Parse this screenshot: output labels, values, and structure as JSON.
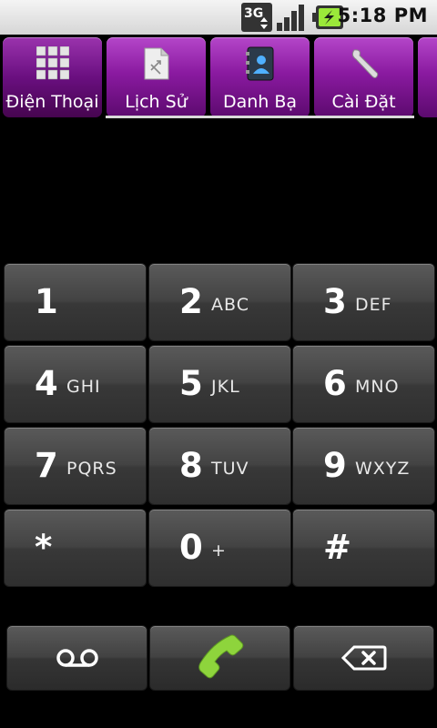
{
  "status_bar": {
    "network": "3G",
    "time": "5:18 PM"
  },
  "tabs": [
    {
      "label": "Điện Thoại",
      "icon": "dialpad-icon",
      "selected": true
    },
    {
      "label": "Lịch Sử",
      "icon": "call-log-icon",
      "selected": false
    },
    {
      "label": "Danh Bạ",
      "icon": "contacts-icon",
      "selected": false
    },
    {
      "label": "Cài Đặt",
      "icon": "wrench-icon",
      "selected": false
    }
  ],
  "keypad": [
    {
      "digit": "1",
      "letters": ""
    },
    {
      "digit": "2",
      "letters": "ABC"
    },
    {
      "digit": "3",
      "letters": "DEF"
    },
    {
      "digit": "4",
      "letters": "GHI"
    },
    {
      "digit": "5",
      "letters": "JKL"
    },
    {
      "digit": "6",
      "letters": "MNO"
    },
    {
      "digit": "7",
      "letters": "PQRS"
    },
    {
      "digit": "8",
      "letters": "TUV"
    },
    {
      "digit": "9",
      "letters": "WXYZ"
    },
    {
      "digit": "*",
      "letters": ""
    },
    {
      "digit": "0",
      "letters": "+"
    },
    {
      "digit": "#",
      "letters": ""
    }
  ],
  "actions": {
    "voicemail_icon": "voicemail-icon",
    "call_icon": "phone-handset-icon",
    "delete_icon": "backspace-icon"
  },
  "colors": {
    "tab_purple": "#8a1aa0",
    "call_green": "#8ed43c"
  }
}
